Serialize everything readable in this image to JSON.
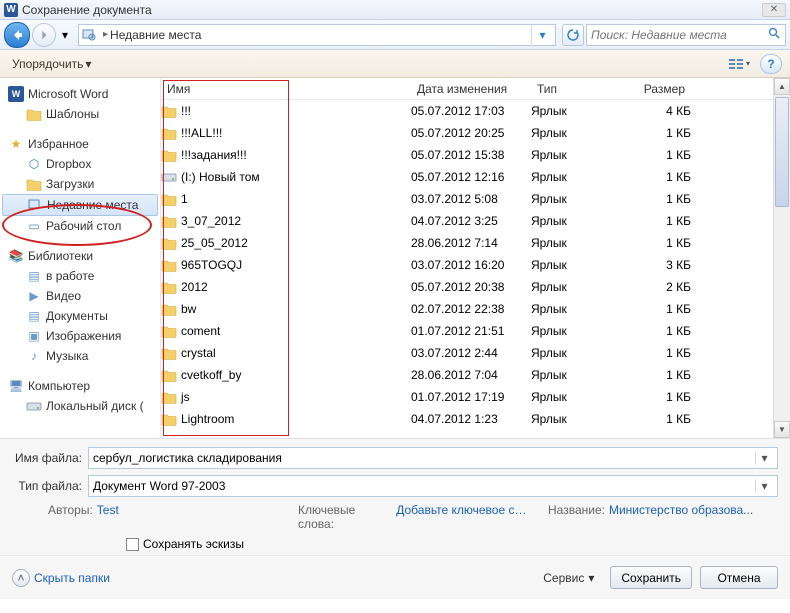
{
  "title": "Сохранение документа",
  "breadcrumb": {
    "location": "Недавние места"
  },
  "search": {
    "placeholder": "Поиск: Недавние места"
  },
  "toolbar": {
    "organize": "Упорядочить"
  },
  "sidebar": {
    "word": "Microsoft Word",
    "templates": "Шаблоны",
    "favorites": "Избранное",
    "dropbox": "Dropbox",
    "downloads": "Загрузки",
    "recent": "Недавние места",
    "desktop": "Рабочий стол",
    "libraries": "Библиотеки",
    "inwork": "в работе",
    "video": "Видео",
    "documents": "Документы",
    "images": "Изображения",
    "music": "Музыка",
    "computer": "Компьютер",
    "localdisk": "Локальный диск ("
  },
  "columns": {
    "name": "Имя",
    "date": "Дата изменения",
    "type": "Тип",
    "size": "Размер"
  },
  "files": [
    {
      "name": "!!!",
      "date": "05.07.2012 17:03",
      "type": "Ярлык",
      "size": "4 КБ",
      "icon": "folder"
    },
    {
      "name": "!!!ALL!!!",
      "date": "05.07.2012 20:25",
      "type": "Ярлык",
      "size": "1 КБ",
      "icon": "folder"
    },
    {
      "name": "!!!задания!!!",
      "date": "05.07.2012 15:38",
      "type": "Ярлык",
      "size": "1 КБ",
      "icon": "folder"
    },
    {
      "name": "(I:) Новый том",
      "date": "05.07.2012 12:16",
      "type": "Ярлык",
      "size": "1 КБ",
      "icon": "drive"
    },
    {
      "name": "1",
      "date": "03.07.2012 5:08",
      "type": "Ярлык",
      "size": "1 КБ",
      "icon": "folder"
    },
    {
      "name": "3_07_2012",
      "date": "04.07.2012 3:25",
      "type": "Ярлык",
      "size": "1 КБ",
      "icon": "folder"
    },
    {
      "name": "25_05_2012",
      "date": "28.06.2012 7:14",
      "type": "Ярлык",
      "size": "1 КБ",
      "icon": "folder"
    },
    {
      "name": "965TOGQJ",
      "date": "03.07.2012 16:20",
      "type": "Ярлык",
      "size": "3 КБ",
      "icon": "folder"
    },
    {
      "name": "2012",
      "date": "05.07.2012 20:38",
      "type": "Ярлык",
      "size": "2 КБ",
      "icon": "folder"
    },
    {
      "name": "bw",
      "date": "02.07.2012 22:38",
      "type": "Ярлык",
      "size": "1 КБ",
      "icon": "folder"
    },
    {
      "name": "coment",
      "date": "01.07.2012 21:51",
      "type": "Ярлык",
      "size": "1 КБ",
      "icon": "folder"
    },
    {
      "name": "crystal",
      "date": "03.07.2012 2:44",
      "type": "Ярлык",
      "size": "1 КБ",
      "icon": "folder"
    },
    {
      "name": "cvetkoff_by",
      "date": "28.06.2012 7:04",
      "type": "Ярлык",
      "size": "1 КБ",
      "icon": "folder"
    },
    {
      "name": "js",
      "date": "01.07.2012 17:19",
      "type": "Ярлык",
      "size": "1 КБ",
      "icon": "folder"
    },
    {
      "name": "Lightroom",
      "date": "04.07.2012 1:23",
      "type": "Ярлык",
      "size": "1 КБ",
      "icon": "folder"
    }
  ],
  "filename": {
    "label": "Имя файла:",
    "value": "сербул_логистика складирования"
  },
  "filetype": {
    "label": "Тип файла:",
    "value": "Документ Word 97-2003"
  },
  "meta": {
    "authors_label": "Авторы:",
    "authors_value": "Test",
    "keywords_label": "Ключевые слова:",
    "keywords_value": "Добавьте ключевое сл...",
    "title_label": "Название:",
    "title_value": "Министерство образова..."
  },
  "thumbnails": "Сохранять эскизы",
  "footer": {
    "hide": "Скрыть папки",
    "tools": "Сервис",
    "save": "Сохранить",
    "cancel": "Отмена"
  }
}
